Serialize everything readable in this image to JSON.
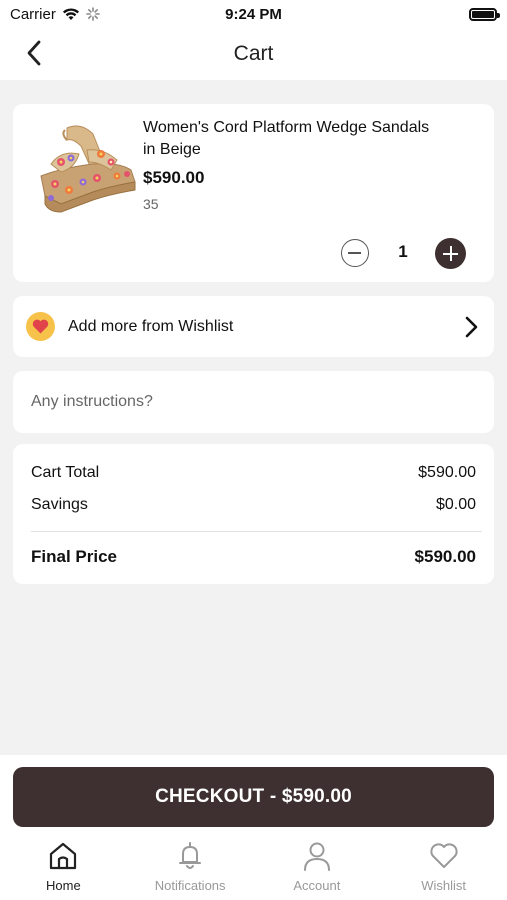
{
  "status_bar": {
    "carrier": "Carrier",
    "time": "9:24 PM"
  },
  "nav": {
    "title": "Cart"
  },
  "cart_item": {
    "name": "Women's Cord Platform Wedge Sandals in Beige",
    "price": "$590.00",
    "size": "35",
    "quantity": "1"
  },
  "wishlist": {
    "label": "Add more from Wishlist"
  },
  "instructions": {
    "placeholder": "Any instructions?",
    "value": ""
  },
  "summary": {
    "cart_total_label": "Cart Total",
    "cart_total_value": "$590.00",
    "savings_label": "Savings",
    "savings_value": "$0.00",
    "final_label": "Final Price",
    "final_value": "$590.00"
  },
  "checkout": {
    "label": "CHECKOUT - $590.00"
  },
  "tabs": [
    {
      "label": "Home",
      "icon": "home-icon",
      "active": true
    },
    {
      "label": "Notifications",
      "icon": "bell-icon",
      "active": false
    },
    {
      "label": "Account",
      "icon": "user-icon",
      "active": false
    },
    {
      "label": "Wishlist",
      "icon": "heart-icon",
      "active": false
    }
  ],
  "colors": {
    "accent": "#3e3030",
    "background": "#f2f2f2",
    "wishlist_badge": "#f7c24a"
  }
}
